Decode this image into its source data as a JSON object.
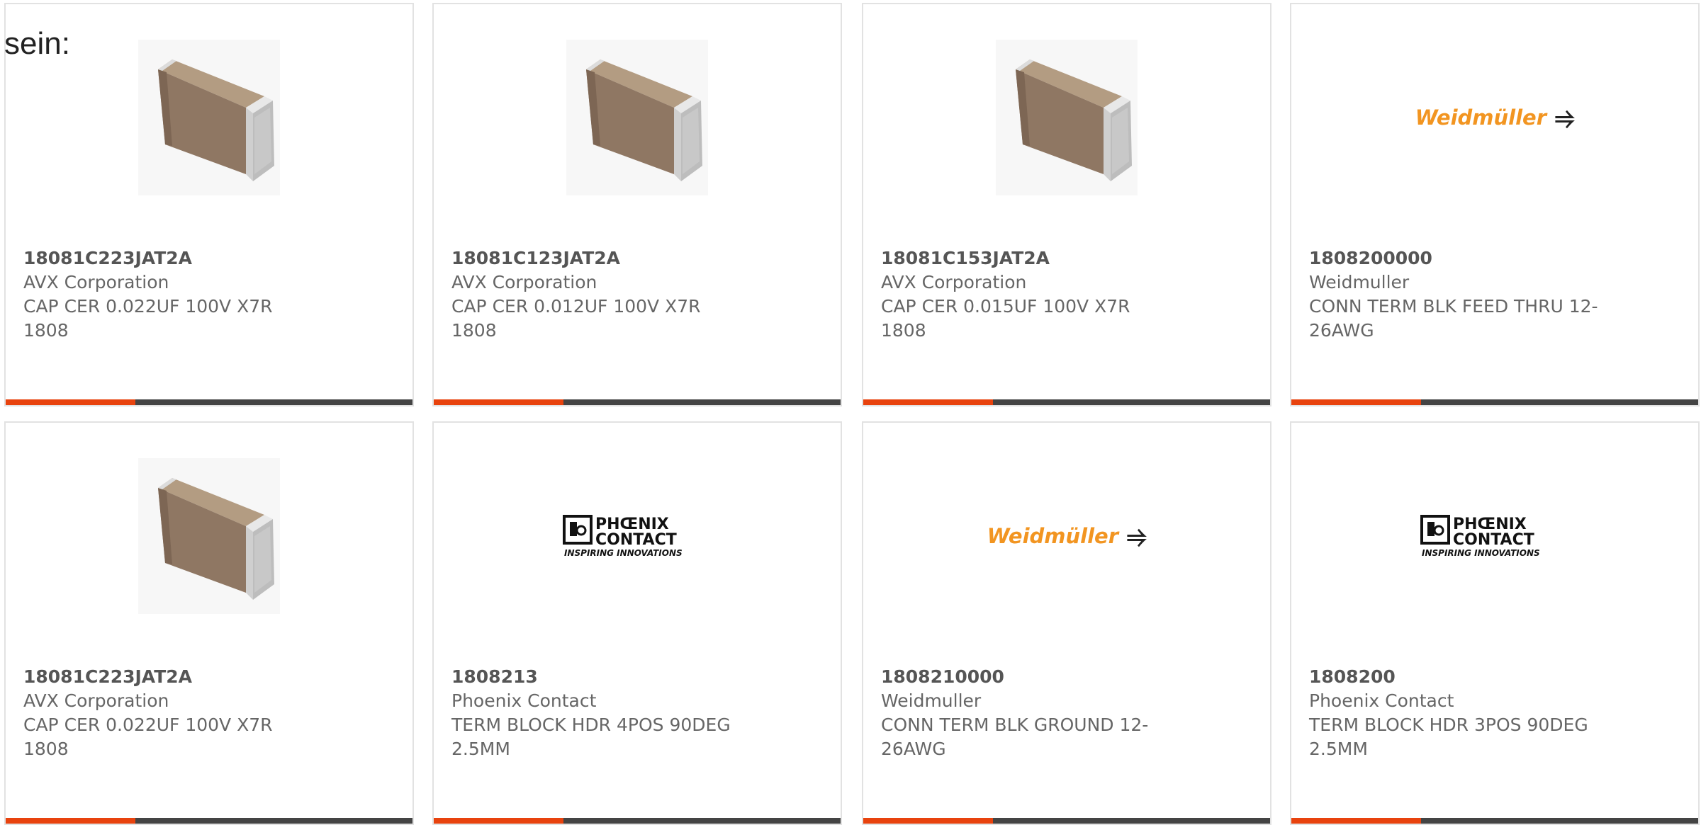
{
  "lead_text": "sein:",
  "colors": {
    "accent": "#e8430e",
    "bar": "#444444",
    "card_border": "#e2e2e2",
    "weidmuller": "#f29521"
  },
  "cards": [
    {
      "part_number": "18081C223JAT2A",
      "manufacturer": "AVX Corporation",
      "description": "CAP CER 0.022UF 100V X7R 1808",
      "image": "ceramic-capacitor"
    },
    {
      "part_number": "18081C123JAT2A",
      "manufacturer": "AVX Corporation",
      "description": "CAP CER 0.012UF 100V X7R 1808",
      "image": "ceramic-capacitor"
    },
    {
      "part_number": "18081C153JAT2A",
      "manufacturer": "AVX Corporation",
      "description": "CAP CER 0.015UF 100V X7R 1808",
      "image": "ceramic-capacitor"
    },
    {
      "part_number": "1808200000",
      "manufacturer": "Weidmuller",
      "description": "CONN TERM BLK FEED THRU 12-26AWG",
      "image": "weidmuller-logo"
    },
    {
      "part_number": "18081C223JAT2A",
      "manufacturer": "AVX Corporation",
      "description": "CAP CER 0.022UF 100V X7R 1808",
      "image": "ceramic-capacitor"
    },
    {
      "part_number": "1808213",
      "manufacturer": "Phoenix Contact",
      "description": "TERM BLOCK HDR 4POS 90DEG 2.5MM",
      "image": "phoenix-contact-logo"
    },
    {
      "part_number": "1808210000",
      "manufacturer": "Weidmuller",
      "description": "CONN TERM BLK GROUND 12-26AWG",
      "image": "weidmuller-logo"
    },
    {
      "part_number": "1808200",
      "manufacturer": "Phoenix Contact",
      "description": "TERM BLOCK HDR 3POS 90DEG 2.5MM",
      "image": "phoenix-contact-logo"
    }
  ],
  "logos": {
    "weidmuller": "Weidmüller",
    "phoenix_line1": "PHŒNIX",
    "phoenix_line2": "CONTACT",
    "phoenix_tagline": "INSPIRING INNOVATIONS"
  }
}
